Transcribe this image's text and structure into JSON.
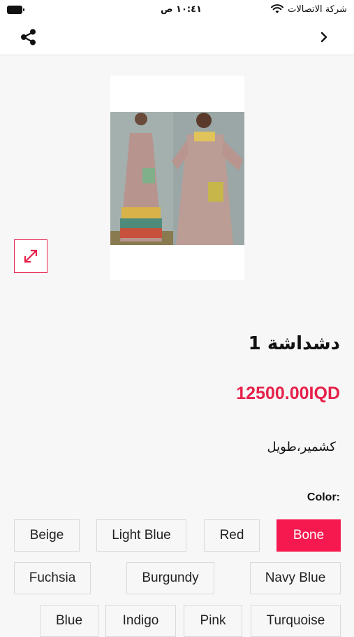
{
  "status_bar": {
    "carrier": "شركة الاتصالات",
    "time": "١٠:٤١ ص"
  },
  "nav": {
    "share_icon": "share-icon",
    "back_icon": "chevron-right-icon"
  },
  "product": {
    "image_icon": "product-photo",
    "title": "دشداشة 1",
    "price": "12500.00IQD",
    "description": "كشمير،طويل",
    "accent_color": "#e6214a"
  },
  "color_section": {
    "label": "Color:",
    "selected": "Bone",
    "options": [
      "Bone",
      "Red",
      "Light Blue",
      "Beige",
      "Navy Blue",
      "Burgundy",
      "Fuchsia",
      "Turquoise",
      "Pink",
      "Indigo",
      "Blue"
    ]
  }
}
